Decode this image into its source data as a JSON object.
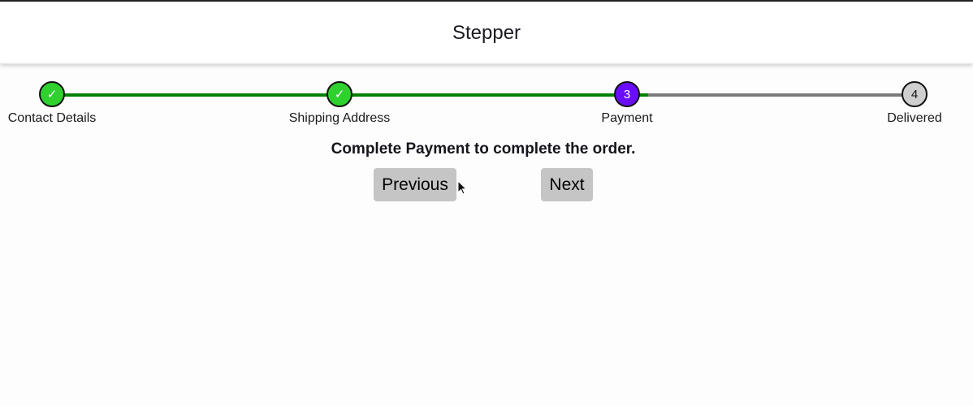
{
  "header": {
    "title": "Stepper"
  },
  "stepper": {
    "current_step": 3,
    "colors": {
      "complete": "#2ed12e",
      "current": "#6a0dff",
      "pending": "#cfcfcf",
      "track_done": "#008000",
      "track_pending": "#7a7a7a"
    },
    "steps": [
      {
        "label": "Contact Details",
        "marker": "✓",
        "status": "complete"
      },
      {
        "label": "Shipping Address",
        "marker": "✓",
        "status": "complete"
      },
      {
        "label": "Payment",
        "marker": "3",
        "status": "current"
      },
      {
        "label": "Delivered",
        "marker": "4",
        "status": "pending"
      }
    ]
  },
  "main": {
    "message": "Complete Payment to complete the order.",
    "previous_label": "Previous",
    "next_label": "Next"
  }
}
